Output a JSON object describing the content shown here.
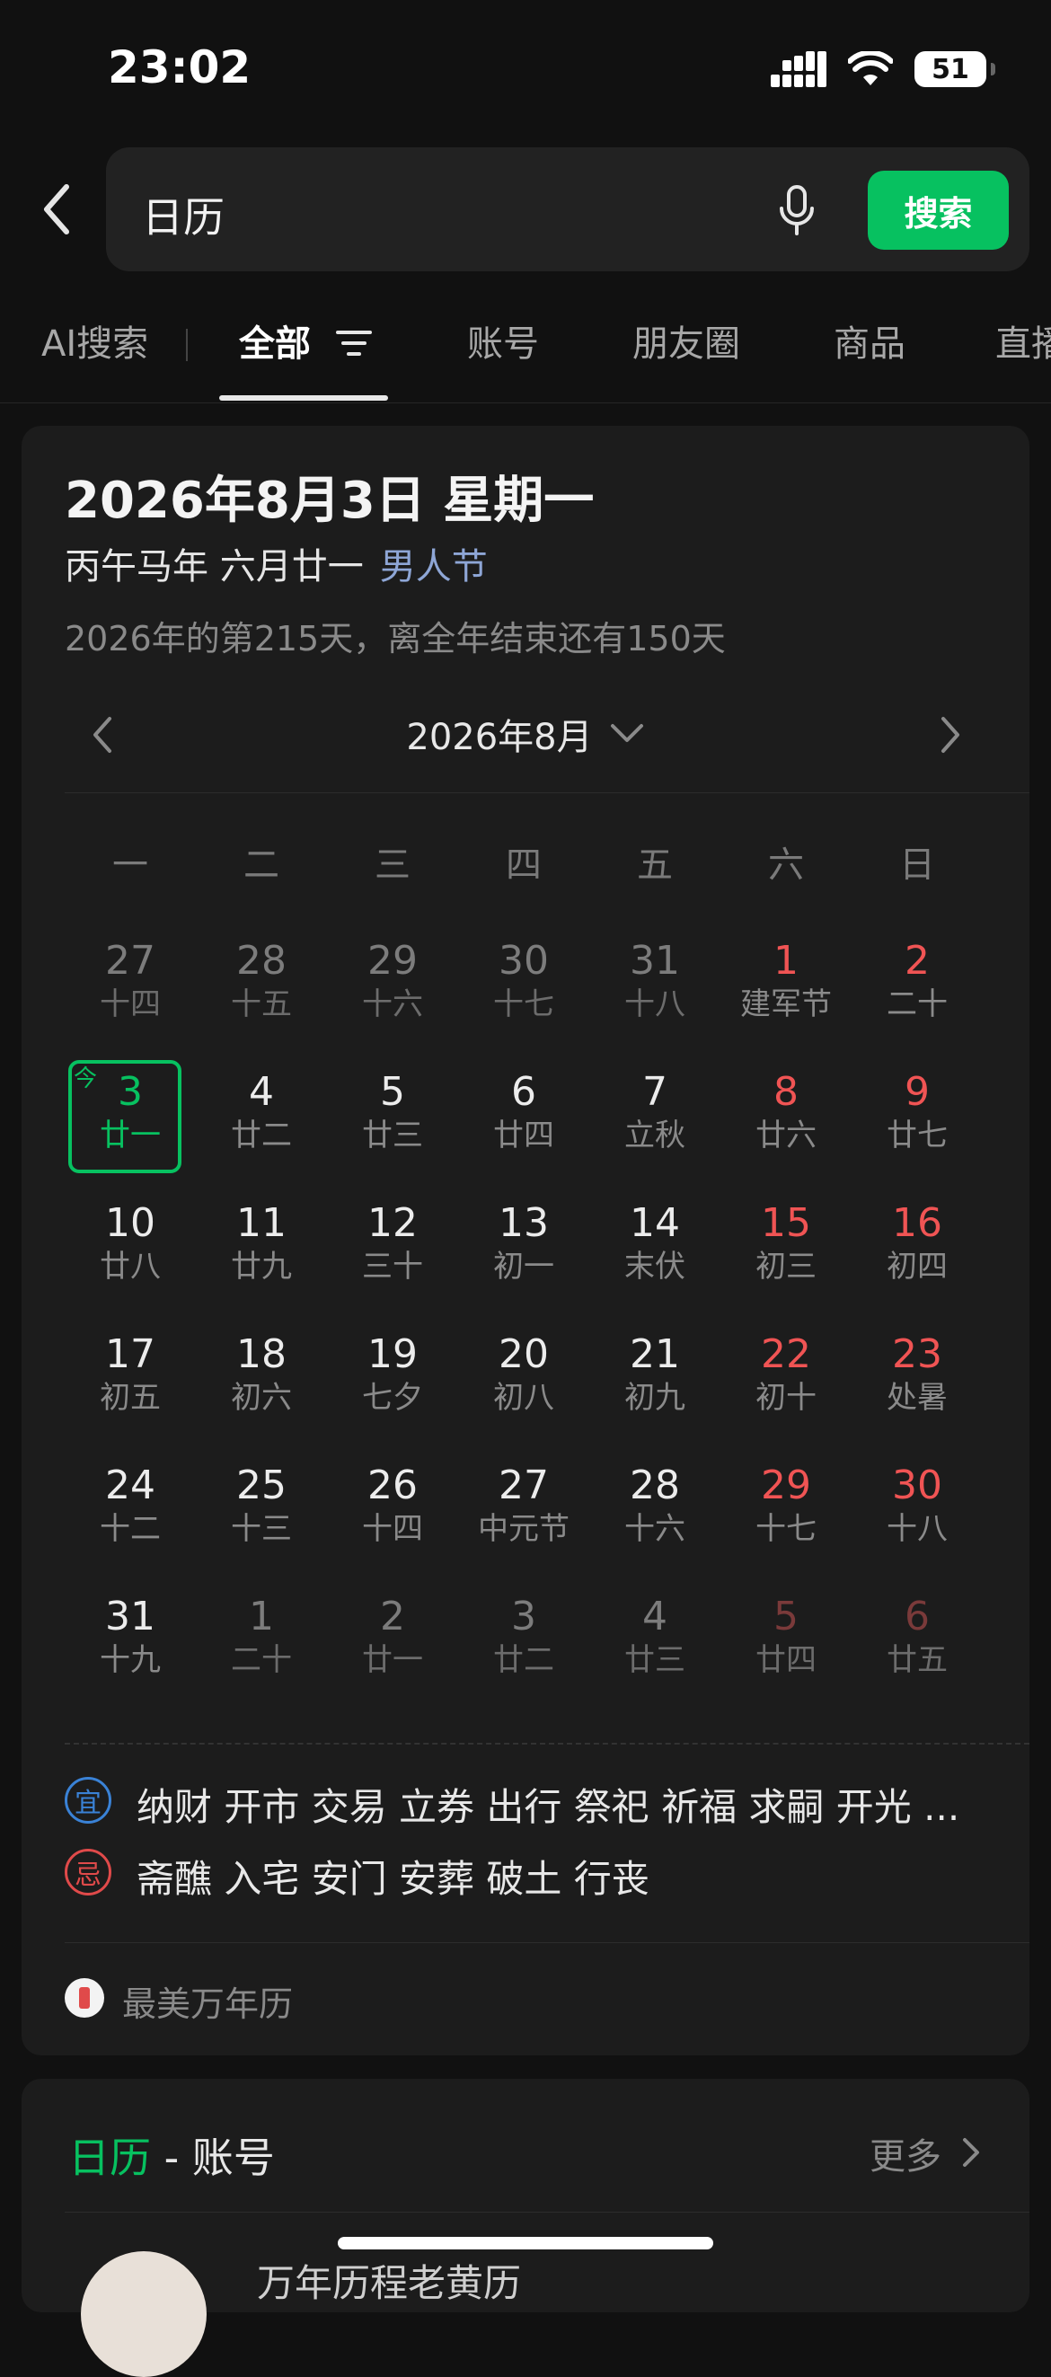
{
  "status_bar": {
    "time": "23:02",
    "battery": "51"
  },
  "search": {
    "query": "日历",
    "button_label": "搜索"
  },
  "tabs": [
    {
      "label": "AI搜索"
    },
    {
      "label": "全部"
    },
    {
      "label": "账号"
    },
    {
      "label": "朋友圈"
    },
    {
      "label": "商品"
    },
    {
      "label": "直播"
    }
  ],
  "calendar": {
    "date_title": "2026年8月3日 星期一",
    "lunar": "丙午马年 六月廿一",
    "festival": "男人节",
    "day_info": "2026年的第215天，离全年结束还有150天",
    "month_label": "2026年8月",
    "weekdays": [
      "一",
      "二",
      "三",
      "四",
      "五",
      "六",
      "日"
    ],
    "today_tag": "今",
    "weeks": [
      [
        {
          "d": "27",
          "l": "十四",
          "other": true
        },
        {
          "d": "28",
          "l": "十五",
          "other": true
        },
        {
          "d": "29",
          "l": "十六",
          "other": true
        },
        {
          "d": "30",
          "l": "十七",
          "other": true
        },
        {
          "d": "31",
          "l": "十八",
          "other": true
        },
        {
          "d": "1",
          "l": "建军节"
        },
        {
          "d": "2",
          "l": "二十"
        }
      ],
      [
        {
          "d": "3",
          "l": "廿一",
          "today": true
        },
        {
          "d": "4",
          "l": "廿二"
        },
        {
          "d": "5",
          "l": "廿三"
        },
        {
          "d": "6",
          "l": "廿四"
        },
        {
          "d": "7",
          "l": "立秋"
        },
        {
          "d": "8",
          "l": "廿六"
        },
        {
          "d": "9",
          "l": "廿七"
        }
      ],
      [
        {
          "d": "10",
          "l": "廿八"
        },
        {
          "d": "11",
          "l": "廿九"
        },
        {
          "d": "12",
          "l": "三十"
        },
        {
          "d": "13",
          "l": "初一"
        },
        {
          "d": "14",
          "l": "末伏"
        },
        {
          "d": "15",
          "l": "初三"
        },
        {
          "d": "16",
          "l": "初四"
        }
      ],
      [
        {
          "d": "17",
          "l": "初五"
        },
        {
          "d": "18",
          "l": "初六"
        },
        {
          "d": "19",
          "l": "七夕"
        },
        {
          "d": "20",
          "l": "初八"
        },
        {
          "d": "21",
          "l": "初九"
        },
        {
          "d": "22",
          "l": "初十"
        },
        {
          "d": "23",
          "l": "处暑"
        }
      ],
      [
        {
          "d": "24",
          "l": "十二"
        },
        {
          "d": "25",
          "l": "十三"
        },
        {
          "d": "26",
          "l": "十四"
        },
        {
          "d": "27",
          "l": "中元节"
        },
        {
          "d": "28",
          "l": "十六"
        },
        {
          "d": "29",
          "l": "十七"
        },
        {
          "d": "30",
          "l": "十八"
        }
      ],
      [
        {
          "d": "31",
          "l": "十九"
        },
        {
          "d": "1",
          "l": "二十",
          "other": true
        },
        {
          "d": "2",
          "l": "廿一",
          "other": true
        },
        {
          "d": "3",
          "l": "廿二",
          "other": true
        },
        {
          "d": "4",
          "l": "廿三",
          "other": true
        },
        {
          "d": "5",
          "l": "廿四",
          "other": true
        },
        {
          "d": "6",
          "l": "廿五",
          "other": true
        }
      ]
    ],
    "yi_label": "宜",
    "yi_text": "纳财 开市 交易 立券 出行 祭祀 祈福 求嗣 开光 ...",
    "ji_label": "忌",
    "ji_text": "斋醮 入宅 安门 安葬 破土 行丧",
    "source": "最美万年历"
  },
  "accounts_card": {
    "title_highlight": "日历",
    "title_rest": " - 账号",
    "more": "更多",
    "next_item": "万年历程老黄历"
  },
  "colors": {
    "accent": "#07c160",
    "weekend": "#f05454",
    "festival": "#8ea6d6",
    "background": "#111111",
    "card": "#1c1c1c"
  }
}
